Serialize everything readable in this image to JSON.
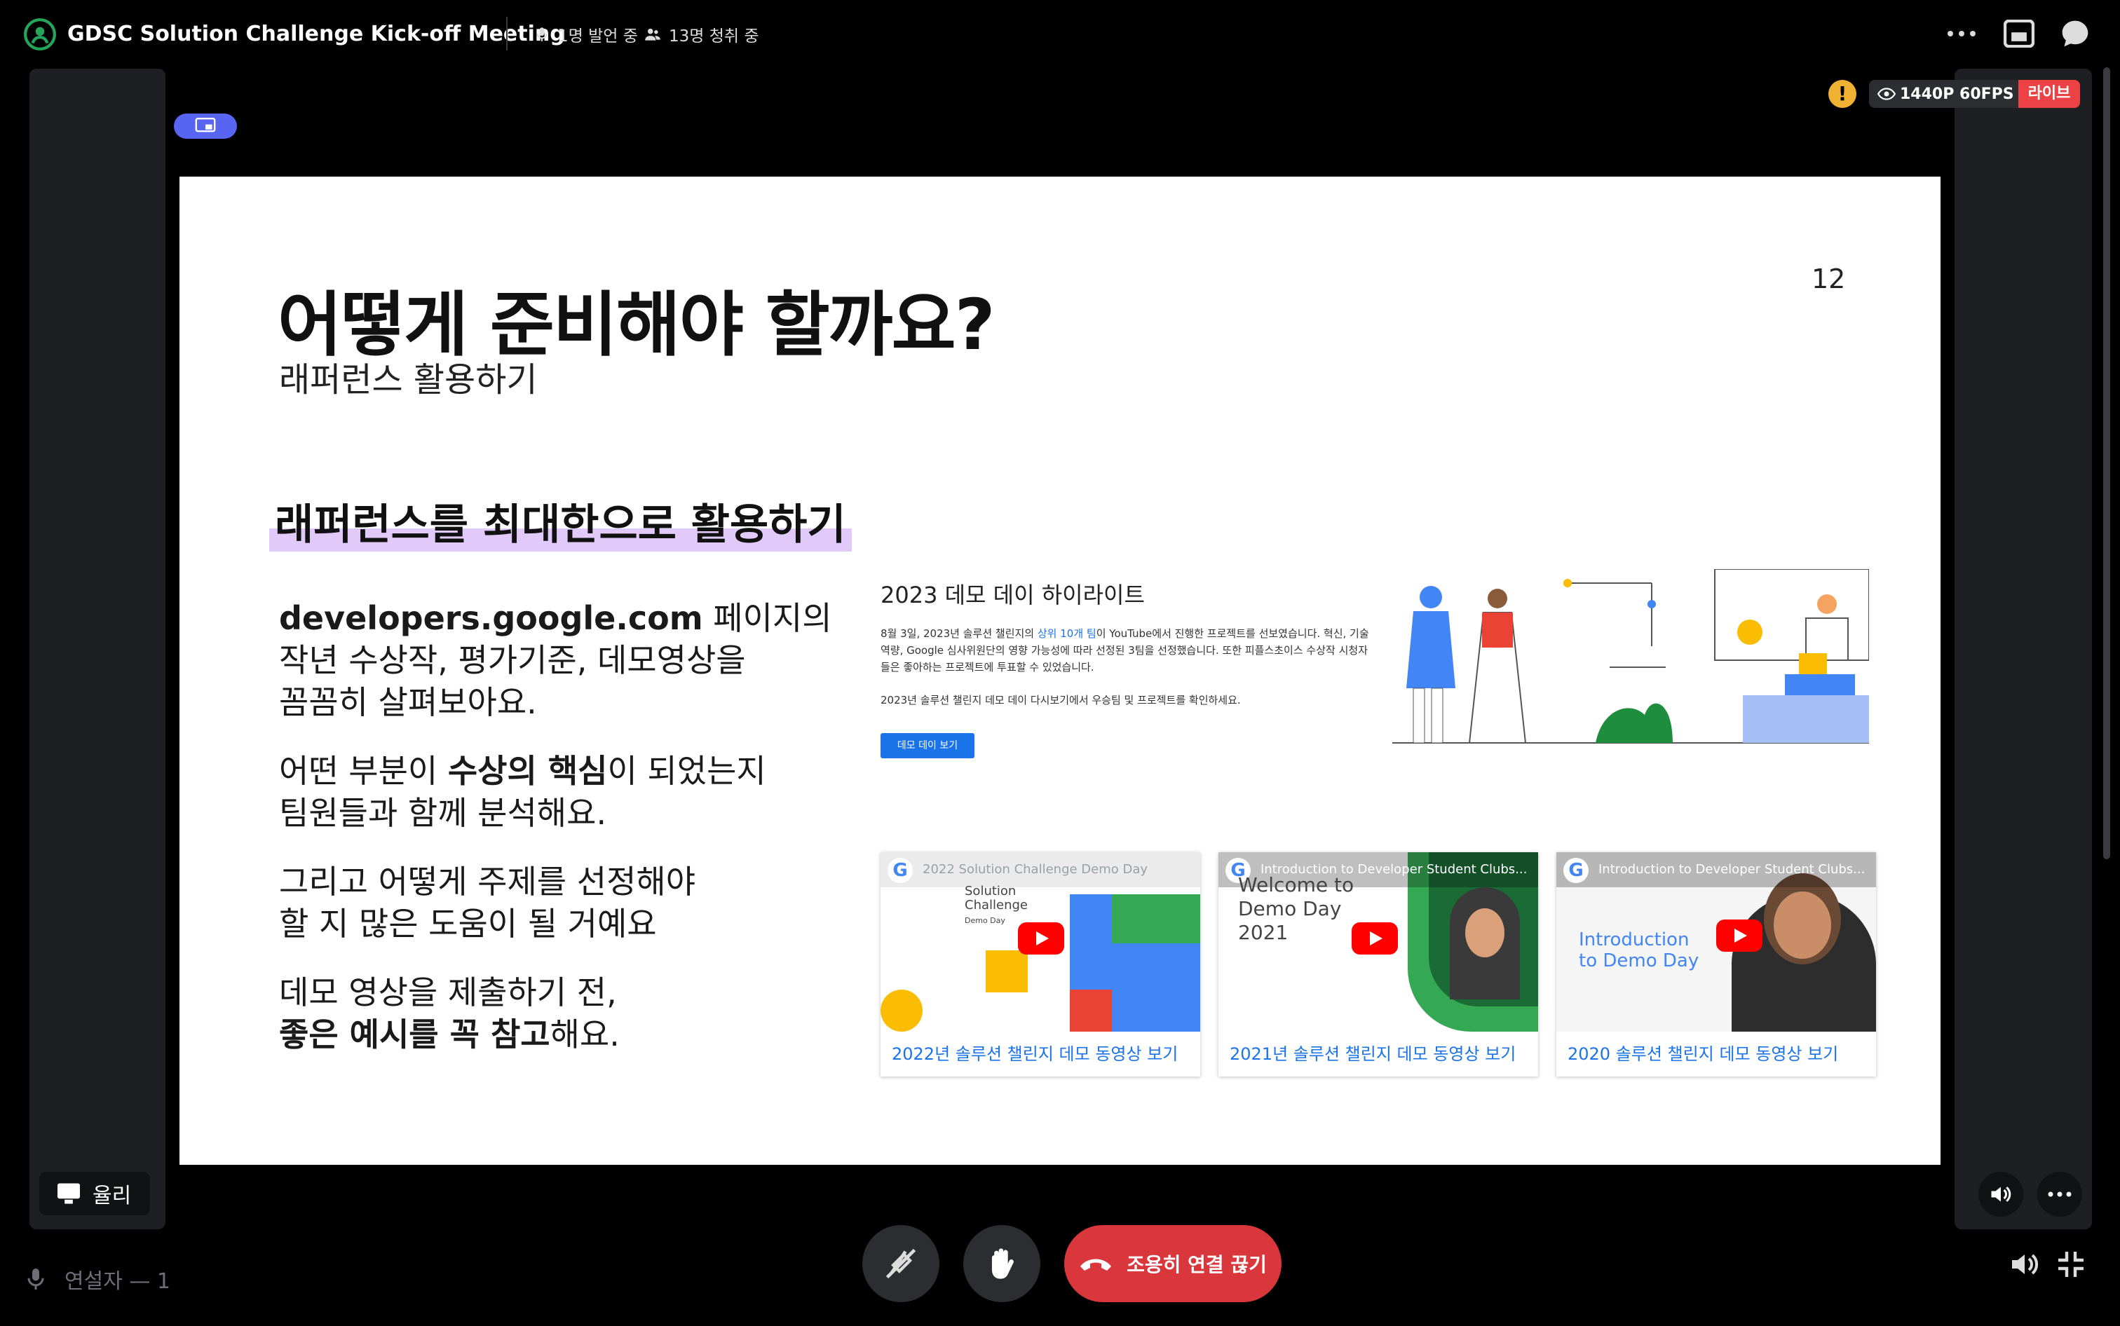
{
  "header": {
    "title": "GDSC Solution Challenge Kick-off Meeting",
    "speakers": "1명 발언 중",
    "listeners": "13명 청취 중"
  },
  "stream": {
    "quality": "1440P 60FPS",
    "live_label": "라이브",
    "warning": "!"
  },
  "slide": {
    "title": "어떻게 준비해야 할까요?",
    "subtitle": "래퍼런스 활용하기",
    "page": "12",
    "section": "래퍼런스를 최대한으로 활용하기",
    "bullets": [
      {
        "line1_bold": "developers.google.com",
        "line1_rest": " 페이지의",
        "line2": "작년 수상작, 평가기준, 데모영상을",
        "line3": "꼼꼼히 살펴보아요."
      },
      {
        "line1_pre": "어떤 부분이 ",
        "line1_bold": "수상의 핵심",
        "line1_post": "이 되었는지",
        "line2": "팀원들과 함께 분석해요."
      },
      {
        "line1": "그리고 어떻게 주제를 선정해야",
        "line2": "할 지 많은 도움이 될 거예요"
      },
      {
        "line1": "데모 영상을 제출하기 전,",
        "line2_bold": "좋은 예시를 꼭 참고",
        "line2_post": "해요."
      }
    ],
    "highlight": {
      "title": "2023 데모 데이 하이라이트",
      "text_pre": "8월 3일, 2023년 솔루션 챌린지의 ",
      "text_link": "상위 10개 팀",
      "text_post": "이 YouTube에서 진행한 프로젝트를 선보였습니다. 혁신, 기술 역량, Google 심사위원단의 영향 가능성에 따라 선정된 3팀을 선정했습니다. 또한 피플스초이스 수상작 시청자들은 좋아하는 프로젝트에 투표할 수 있었습니다.",
      "text2": "2023년 솔루션 챌린지 데모 데이 다시보기에서 우승팀 및 프로젝트를 확인하세요.",
      "button": "데모 데이 보기"
    },
    "videos": [
      {
        "bar": "2022 Solution Challenge Demo Day",
        "thumb_text1": "Solution",
        "thumb_text2": "Challenge",
        "thumb_text3": "Demo Day",
        "caption": "2022년 솔루션 챌린지 데모 동영상 보기"
      },
      {
        "bar": "Introduction to Developer Student Clubs...",
        "thumb_text1": "Welcome to",
        "thumb_text2": "Demo Day",
        "thumb_text3": "2021",
        "caption": "2021년 솔루션 챌린지 데모 동영상 보기"
      },
      {
        "bar": "Introduction to Developer Student Clubs...",
        "thumb_text1": "Introduction",
        "thumb_text2": "to Demo Day",
        "thumb_text3": "",
        "caption": "2020 솔루션 챌린지 데모 동영상 보기"
      }
    ]
  },
  "presenter": {
    "name": "율리"
  },
  "footer": {
    "speaker_label": "연설자 — 1",
    "leave_label": "조용히 연결 끊기"
  },
  "colors": {
    "accent": "#5865f2",
    "live": "#ed4245",
    "leave": "#da373c",
    "stage": "#23a55a",
    "warning": "#f0b232"
  }
}
